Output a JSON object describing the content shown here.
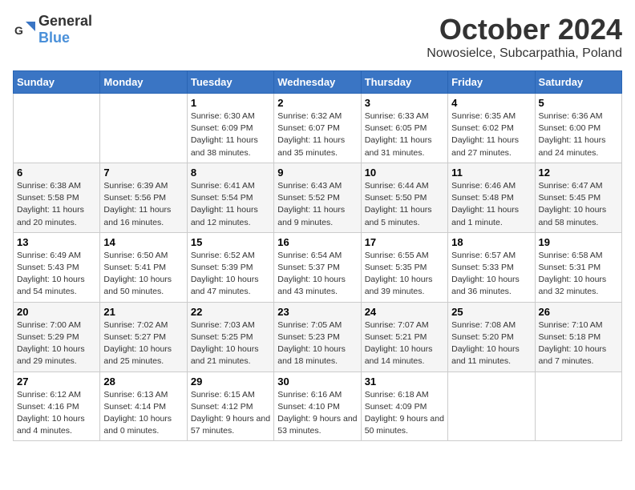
{
  "header": {
    "logo_general": "General",
    "logo_blue": "Blue",
    "month_title": "October 2024",
    "location": "Nowosielce, Subcarpathia, Poland"
  },
  "weekdays": [
    "Sunday",
    "Monday",
    "Tuesday",
    "Wednesday",
    "Thursday",
    "Friday",
    "Saturday"
  ],
  "weeks": [
    [
      {
        "day": "",
        "info": ""
      },
      {
        "day": "",
        "info": ""
      },
      {
        "day": "1",
        "info": "Sunrise: 6:30 AM\nSunset: 6:09 PM\nDaylight: 11 hours and 38 minutes."
      },
      {
        "day": "2",
        "info": "Sunrise: 6:32 AM\nSunset: 6:07 PM\nDaylight: 11 hours and 35 minutes."
      },
      {
        "day": "3",
        "info": "Sunrise: 6:33 AM\nSunset: 6:05 PM\nDaylight: 11 hours and 31 minutes."
      },
      {
        "day": "4",
        "info": "Sunrise: 6:35 AM\nSunset: 6:02 PM\nDaylight: 11 hours and 27 minutes."
      },
      {
        "day": "5",
        "info": "Sunrise: 6:36 AM\nSunset: 6:00 PM\nDaylight: 11 hours and 24 minutes."
      }
    ],
    [
      {
        "day": "6",
        "info": "Sunrise: 6:38 AM\nSunset: 5:58 PM\nDaylight: 11 hours and 20 minutes."
      },
      {
        "day": "7",
        "info": "Sunrise: 6:39 AM\nSunset: 5:56 PM\nDaylight: 11 hours and 16 minutes."
      },
      {
        "day": "8",
        "info": "Sunrise: 6:41 AM\nSunset: 5:54 PM\nDaylight: 11 hours and 12 minutes."
      },
      {
        "day": "9",
        "info": "Sunrise: 6:43 AM\nSunset: 5:52 PM\nDaylight: 11 hours and 9 minutes."
      },
      {
        "day": "10",
        "info": "Sunrise: 6:44 AM\nSunset: 5:50 PM\nDaylight: 11 hours and 5 minutes."
      },
      {
        "day": "11",
        "info": "Sunrise: 6:46 AM\nSunset: 5:48 PM\nDaylight: 11 hours and 1 minute."
      },
      {
        "day": "12",
        "info": "Sunrise: 6:47 AM\nSunset: 5:45 PM\nDaylight: 10 hours and 58 minutes."
      }
    ],
    [
      {
        "day": "13",
        "info": "Sunrise: 6:49 AM\nSunset: 5:43 PM\nDaylight: 10 hours and 54 minutes."
      },
      {
        "day": "14",
        "info": "Sunrise: 6:50 AM\nSunset: 5:41 PM\nDaylight: 10 hours and 50 minutes."
      },
      {
        "day": "15",
        "info": "Sunrise: 6:52 AM\nSunset: 5:39 PM\nDaylight: 10 hours and 47 minutes."
      },
      {
        "day": "16",
        "info": "Sunrise: 6:54 AM\nSunset: 5:37 PM\nDaylight: 10 hours and 43 minutes."
      },
      {
        "day": "17",
        "info": "Sunrise: 6:55 AM\nSunset: 5:35 PM\nDaylight: 10 hours and 39 minutes."
      },
      {
        "day": "18",
        "info": "Sunrise: 6:57 AM\nSunset: 5:33 PM\nDaylight: 10 hours and 36 minutes."
      },
      {
        "day": "19",
        "info": "Sunrise: 6:58 AM\nSunset: 5:31 PM\nDaylight: 10 hours and 32 minutes."
      }
    ],
    [
      {
        "day": "20",
        "info": "Sunrise: 7:00 AM\nSunset: 5:29 PM\nDaylight: 10 hours and 29 minutes."
      },
      {
        "day": "21",
        "info": "Sunrise: 7:02 AM\nSunset: 5:27 PM\nDaylight: 10 hours and 25 minutes."
      },
      {
        "day": "22",
        "info": "Sunrise: 7:03 AM\nSunset: 5:25 PM\nDaylight: 10 hours and 21 minutes."
      },
      {
        "day": "23",
        "info": "Sunrise: 7:05 AM\nSunset: 5:23 PM\nDaylight: 10 hours and 18 minutes."
      },
      {
        "day": "24",
        "info": "Sunrise: 7:07 AM\nSunset: 5:21 PM\nDaylight: 10 hours and 14 minutes."
      },
      {
        "day": "25",
        "info": "Sunrise: 7:08 AM\nSunset: 5:20 PM\nDaylight: 10 hours and 11 minutes."
      },
      {
        "day": "26",
        "info": "Sunrise: 7:10 AM\nSunset: 5:18 PM\nDaylight: 10 hours and 7 minutes."
      }
    ],
    [
      {
        "day": "27",
        "info": "Sunrise: 6:12 AM\nSunset: 4:16 PM\nDaylight: 10 hours and 4 minutes."
      },
      {
        "day": "28",
        "info": "Sunrise: 6:13 AM\nSunset: 4:14 PM\nDaylight: 10 hours and 0 minutes."
      },
      {
        "day": "29",
        "info": "Sunrise: 6:15 AM\nSunset: 4:12 PM\nDaylight: 9 hours and 57 minutes."
      },
      {
        "day": "30",
        "info": "Sunrise: 6:16 AM\nSunset: 4:10 PM\nDaylight: 9 hours and 53 minutes."
      },
      {
        "day": "31",
        "info": "Sunrise: 6:18 AM\nSunset: 4:09 PM\nDaylight: 9 hours and 50 minutes."
      },
      {
        "day": "",
        "info": ""
      },
      {
        "day": "",
        "info": ""
      }
    ]
  ]
}
